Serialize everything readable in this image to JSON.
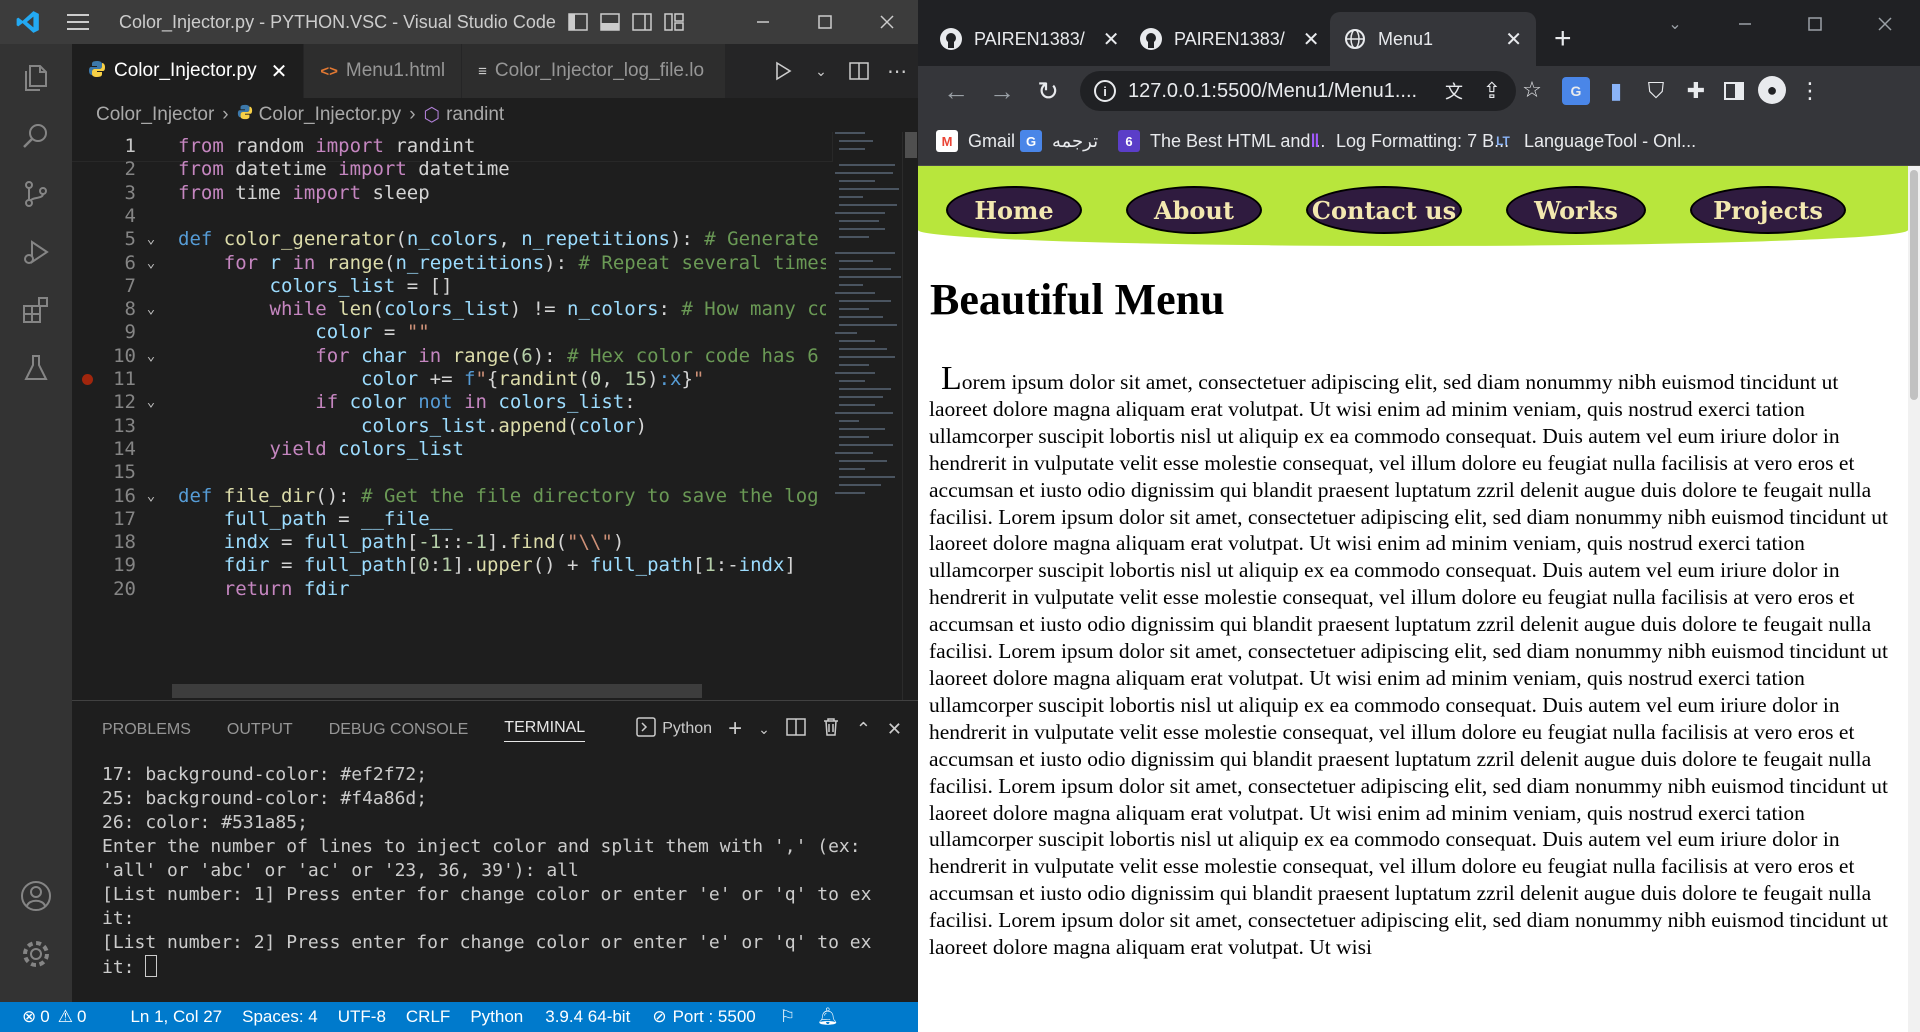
{
  "vscode": {
    "window_title": "Color_Injector.py - PYTHON.VSC - Visual Studio Code",
    "tabs": [
      {
        "label": "Color_Injector.py",
        "icon": "python-icon",
        "active": true
      },
      {
        "label": "Menu1.html",
        "icon": "html-icon",
        "active": false
      },
      {
        "label": "Color_Injector_log_file.lo",
        "icon": "text-file-icon",
        "active": false
      }
    ],
    "breadcrumb": [
      "Color_Injector",
      "Color_Injector.py",
      "randint"
    ],
    "code_lines": [
      {
        "n": "1",
        "html": "<span class='k'>from</span> random <span class='k'>import</span> randint"
      },
      {
        "n": "2",
        "html": "<span class='k'>from</span> datetime <span class='k'>import</span> datetime"
      },
      {
        "n": "3",
        "html": "<span class='k'>from</span> time <span class='k'>import</span> sleep"
      },
      {
        "n": "4",
        "html": ""
      },
      {
        "n": "5",
        "fold": true,
        "html": "<span class='d'>def</span> <span class='f'>color_generator</span>(<span class='v'>n_colors</span>, <span class='v'>n_repetitions</span>): <span class='c'># Generate</span>"
      },
      {
        "n": "6",
        "fold": true,
        "html": "    <span class='k'>for</span> <span class='v'>r</span> <span class='k'>in</span> <span class='f'>range</span>(<span class='v'>n_repetitions</span>): <span class='c'># Repeat several times</span>"
      },
      {
        "n": "7",
        "html": "        <span class='v'>colors_list</span> = []"
      },
      {
        "n": "8",
        "fold": true,
        "html": "        <span class='k'>while</span> <span class='f'>len</span>(<span class='v'>colors_list</span>) != <span class='v'>n_colors</span>: <span class='c'># How many co</span>"
      },
      {
        "n": "9",
        "html": "            <span class='v'>color</span> = <span class='s'>\"\"</span>"
      },
      {
        "n": "10",
        "fold": true,
        "html": "            <span class='k'>for</span> <span class='v'>char</span> <span class='k'>in</span> <span class='f'>range</span>(<span class='n'>6</span>): <span class='c'># Hex color code has 6</span>"
      },
      {
        "n": "11",
        "bp": true,
        "html": "                <span class='v'>color</span> += <span class='d'>f</span><span class='s'>\"</span>{<span class='f'>randint</span>(<span class='n'>0</span>, <span class='n'>15</span>)<span class='d'>:x</span>}<span class='s'>\"</span>"
      },
      {
        "n": "12",
        "fold": true,
        "html": "            <span class='k'>if</span> <span class='v'>color</span> <span class='d'>not</span> <span class='k'>in</span> <span class='v'>colors_list</span>:"
      },
      {
        "n": "13",
        "html": "                <span class='v'>colors_list</span>.<span class='f'>append</span>(<span class='v'>color</span>)"
      },
      {
        "n": "14",
        "html": "        <span class='k'>yield</span> <span class='v'>colors_list</span>"
      },
      {
        "n": "15",
        "html": ""
      },
      {
        "n": "16",
        "fold": true,
        "html": "<span class='d'>def</span> <span class='f'>file_dir</span>(): <span class='c'># Get the file directory to save the log</span>"
      },
      {
        "n": "17",
        "html": "    <span class='v'>full_path</span> = <span class='v'>__file__</span>"
      },
      {
        "n": "18",
        "html": "    <span class='v'>indx</span> = <span class='v'>full_path</span>[<span class='n'>-1</span>::<span class='n'>-1</span>].<span class='f'>find</span>(<span class='s'>\"\\\\\"</span>)"
      },
      {
        "n": "19",
        "html": "    <span class='v'>fdir</span> = <span class='v'>full_path</span>[<span class='n'>0</span>:<span class='n'>1</span>].<span class='f'>upper</span>() + <span class='v'>full_path</span>[<span class='n'>1</span>:-<span class='v'>indx</span>]"
      },
      {
        "n": "20",
        "html": "    <span class='k'>return</span> <span class='v'>fdir</span>"
      }
    ],
    "panel_tabs": [
      "PROBLEMS",
      "OUTPUT",
      "DEBUG CONSOLE",
      "TERMINAL"
    ],
    "terminal_profile": "Python",
    "terminal_lines": [
      "17: background-color: #ef2f72;",
      "25: background-color: #f4a86d;",
      "26: color: #531a85;",
      "Enter the number of lines to inject color and split them with ',' (ex:",
      "'all' or 'abc' or 'ac' or '23, 36, 39'): all",
      "[List number: 1] Press enter for change color or enter 'e' or 'q' to ex",
      "it:",
      "[List number: 2] Press enter for change color or enter 'e' or 'q' to ex",
      "it: "
    ],
    "status": {
      "errors": "0",
      "warnings": "0",
      "position": "Ln 1, Col 27",
      "spaces": "Spaces: 4",
      "encoding": "UTF-8",
      "eol": "CRLF",
      "language": "Python",
      "interpreter": "3.9.4 64-bit",
      "port": "Port : 5500"
    },
    "colors": {
      "accent": "#007acc",
      "keyword": "#c586c0",
      "def": "#569cd6",
      "func": "#dcdcaa",
      "var": "#9cdcfe",
      "string": "#ce9178",
      "comment": "#6a9955",
      "number": "#b5cea8"
    }
  },
  "chrome": {
    "tabs": [
      {
        "label": "PAIREN1383/",
        "icon": "github-icon",
        "active": false
      },
      {
        "label": "PAIREN1383/",
        "icon": "github-icon",
        "active": false
      },
      {
        "label": "Menu1",
        "icon": "globe-icon",
        "active": true
      }
    ],
    "url": "127.0.0.1:5500/Menu1/Menu1....",
    "bookmarks": [
      {
        "label": "Gmail",
        "icon": "gmail-icon"
      },
      {
        "label": "ترجمه",
        "icon": "google-translate-icon"
      },
      {
        "label": "The Best HTML and...",
        "icon": "six-icon"
      },
      {
        "label": "Log Formatting: 7 B...",
        "icon": "bookmark-purple-icon"
      },
      {
        "label": "LanguageTool - Onl...",
        "icon": "languagetool-icon"
      }
    ],
    "page": {
      "nav": [
        "Home",
        "About",
        "Contact us",
        "Works",
        "Projects"
      ],
      "title": "Beautiful Menu",
      "dropcap": "L",
      "body": "orem ipsum dolor sit amet, consectetuer adipiscing elit, sed diam nonummy nibh euismod tincidunt ut laoreet dolore magna aliquam erat volutpat. Ut wisi enim ad minim veniam, quis nostrud exerci tation ullamcorper suscipit lobortis nisl ut aliquip ex ea commodo consequat. Duis autem vel eum iriure dolor in hendrerit in vulputate velit esse molestie consequat, vel illum dolore eu feugiat nulla facilisis at vero eros et accumsan et iusto odio dignissim qui blandit praesent luptatum zzril delenit augue duis dolore te feugait nulla facilisi. Lorem ipsum dolor sit amet, consectetuer adipiscing elit, sed diam nonummy nibh euismod tincidunt ut laoreet dolore magna aliquam erat volutpat. Ut wisi enim ad minim veniam, quis nostrud exerci tation ullamcorper suscipit lobortis nisl ut aliquip ex ea commodo consequat. Duis autem vel eum iriure dolor in hendrerit in vulputate velit esse molestie consequat, vel illum dolore eu feugiat nulla facilisis at vero eros et accumsan et iusto odio dignissim qui blandit praesent luptatum zzril delenit augue duis dolore te feugait nulla facilisi. Lorem ipsum dolor sit amet, consectetuer adipiscing elit, sed diam nonummy nibh euismod tincidunt ut laoreet dolore magna aliquam erat volutpat. Ut wisi enim ad minim veniam, quis nostrud exerci tation ullamcorper suscipit lobortis nisl ut aliquip ex ea commodo consequat. Duis autem vel eum iriure dolor in hendrerit in vulputate velit esse molestie consequat, vel illum dolore eu feugiat nulla facilisis at vero eros et accumsan et iusto odio dignissim qui blandit praesent luptatum zzril delenit augue duis dolore te feugait nulla facilisi. Lorem ipsum dolor sit amet, consectetuer adipiscing elit, sed diam nonummy nibh euismod tincidunt ut laoreet dolore magna aliquam erat volutpat. Ut wisi enim ad minim veniam, quis nostrud exerci tation ullamcorper suscipit lobortis nisl ut aliquip ex ea commodo consequat. Duis autem vel eum iriure dolor in hendrerit in vulputate velit esse molestie consequat, vel illum dolore eu feugiat nulla facilisis at vero eros et accumsan et iusto odio dignissim qui blandit praesent luptatum zzril delenit augue duis dolore te feugait nulla facilisi. Lorem ipsum dolor sit amet, consectetuer adipiscing elit, sed diam nonummy nibh euismod tincidunt ut laoreet dolore magna aliquam erat volutpat. Ut wisi",
      "colors": {
        "nav_bg": "#b8e63c",
        "nav_item_bg": "#2f1b3f",
        "nav_item_text": "#f3e8b0"
      }
    }
  }
}
